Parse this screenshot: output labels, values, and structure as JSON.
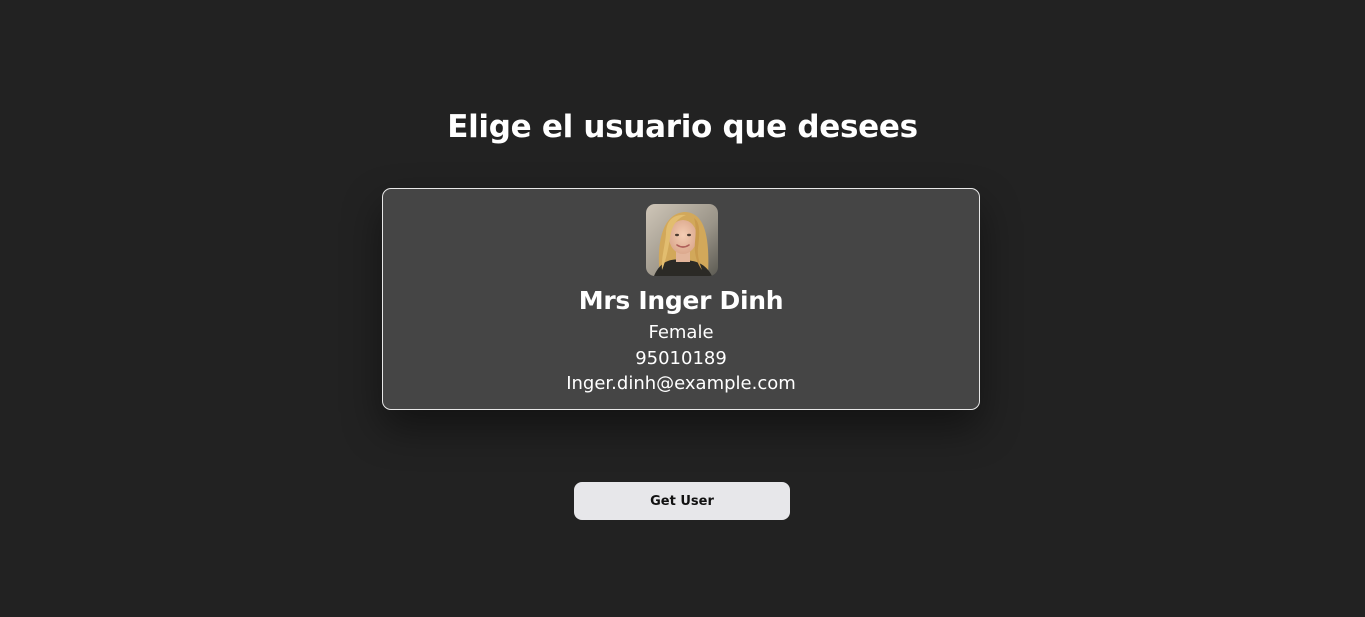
{
  "heading": "Elige el usuario que desees",
  "user": {
    "name": "Mrs Inger Dinh",
    "gender": "Female",
    "phone": "95010189",
    "email": "Inger.dinh@example.com"
  },
  "get_user_button": "Get User",
  "colors": {
    "background": "#222222",
    "card": "#454545",
    "card_border": "#e8e8e8",
    "button": "#e7e7ea",
    "text": "#ffffff"
  }
}
